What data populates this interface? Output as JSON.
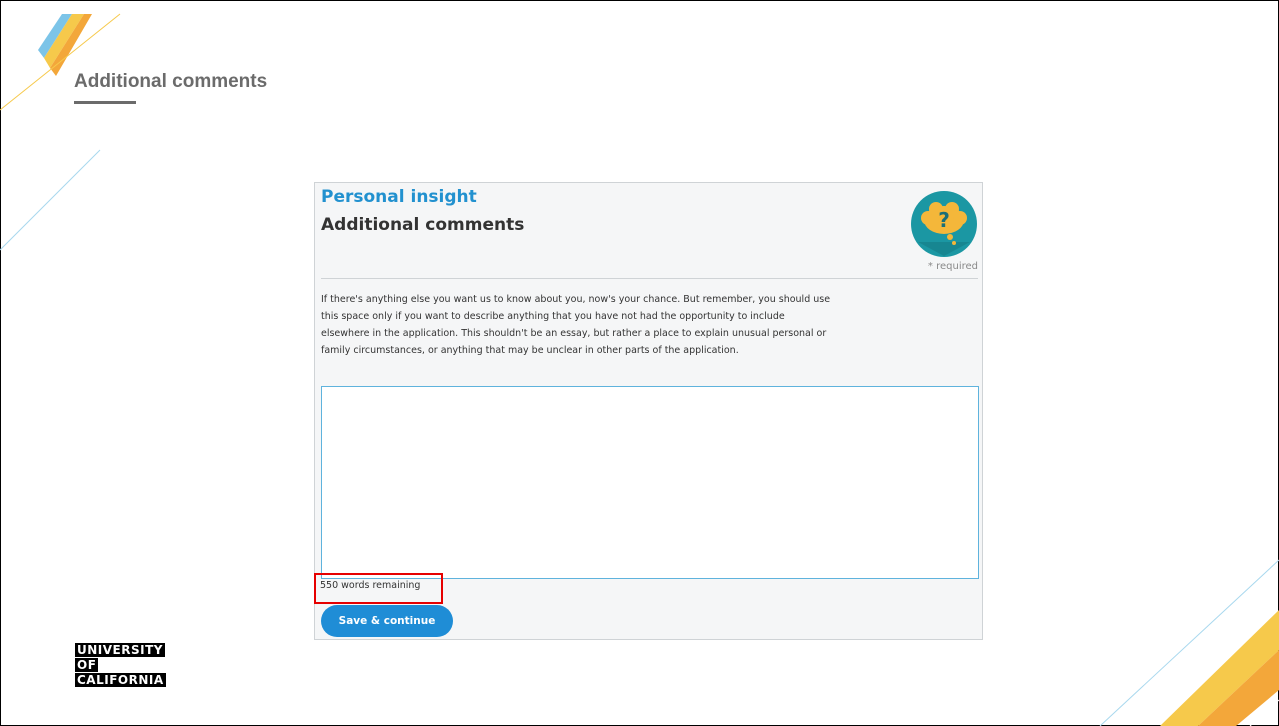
{
  "slide": {
    "title": "Additional comments"
  },
  "form": {
    "section_label": "Personal insight",
    "title": "Additional comments",
    "help_icon": "question-thought-bubble-icon",
    "required_note": "* required",
    "instructions": "If there's anything else you want us to know about you, now's your chance. But remember, you should use this space only if you want to describe anything that you have not had the opportunity to include elsewhere in the application. This shouldn't be an essay, but rather a place to explain unusual personal or family circumstances, or anything that may be unclear in other parts of the application.",
    "essay_value": "",
    "word_count": "550 words remaining",
    "save_label": "Save & continue"
  },
  "logo": {
    "lines": [
      "UNIVERSITY",
      "OF",
      "CALIFORNIA"
    ]
  },
  "colors": {
    "accent_blue": "#1f8dd6",
    "heading_blue": "#2291cf",
    "highlight_red": "#e60000",
    "icon_teal": "#1b97a3",
    "icon_gold": "#f4b73a"
  }
}
